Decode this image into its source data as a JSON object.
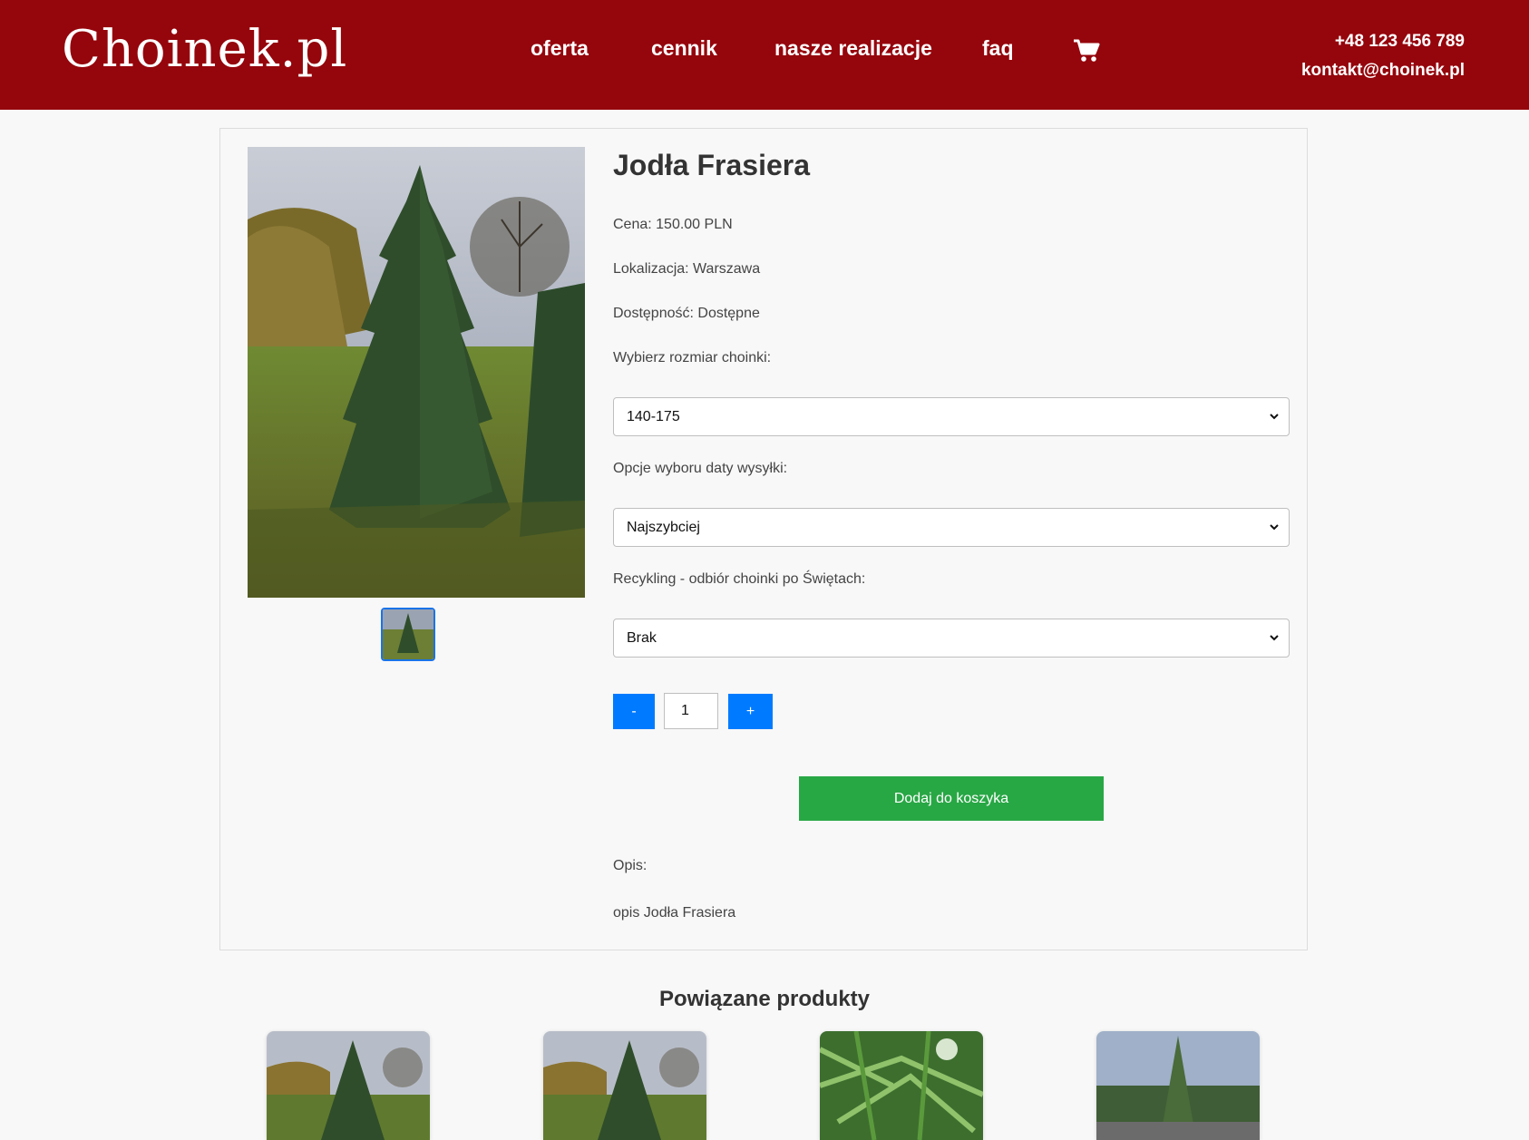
{
  "header": {
    "logo": "Choinek.pl",
    "nav": [
      {
        "label": "oferta"
      },
      {
        "label": "cennik"
      },
      {
        "label": "nasze realizacje"
      },
      {
        "label": "faq"
      }
    ],
    "cart_icon": "cart-icon",
    "phone": "+48 123 456 789",
    "email": "kontakt@choinek.pl",
    "bg_color": "#95050c"
  },
  "product": {
    "title": "Jodła Frasiera",
    "price": "Cena: 150.00 PLN",
    "location": "Lokalizacja: Warszawa",
    "availability": "Dostępność: Dostępne",
    "size_label": "Wybierz rozmiar choinki:",
    "size_value": "140-175",
    "shipping_label": "Opcje wyboru daty wysyłki:",
    "shipping_value": "Najszybciej",
    "recycling_label": "Recykling - odbiór choinki po Świętach:",
    "recycling_value": "Brak",
    "qty_minus": "-",
    "qty_value": "1",
    "qty_plus": "+",
    "add_to_cart": "Dodaj do koszyka",
    "desc_label": "Opis:",
    "desc_text": "opis Jodła Frasiera"
  },
  "related": {
    "title": "Powiązane produkty"
  },
  "colors": {
    "accent_blue": "#007bff",
    "add_green": "#28a745"
  }
}
